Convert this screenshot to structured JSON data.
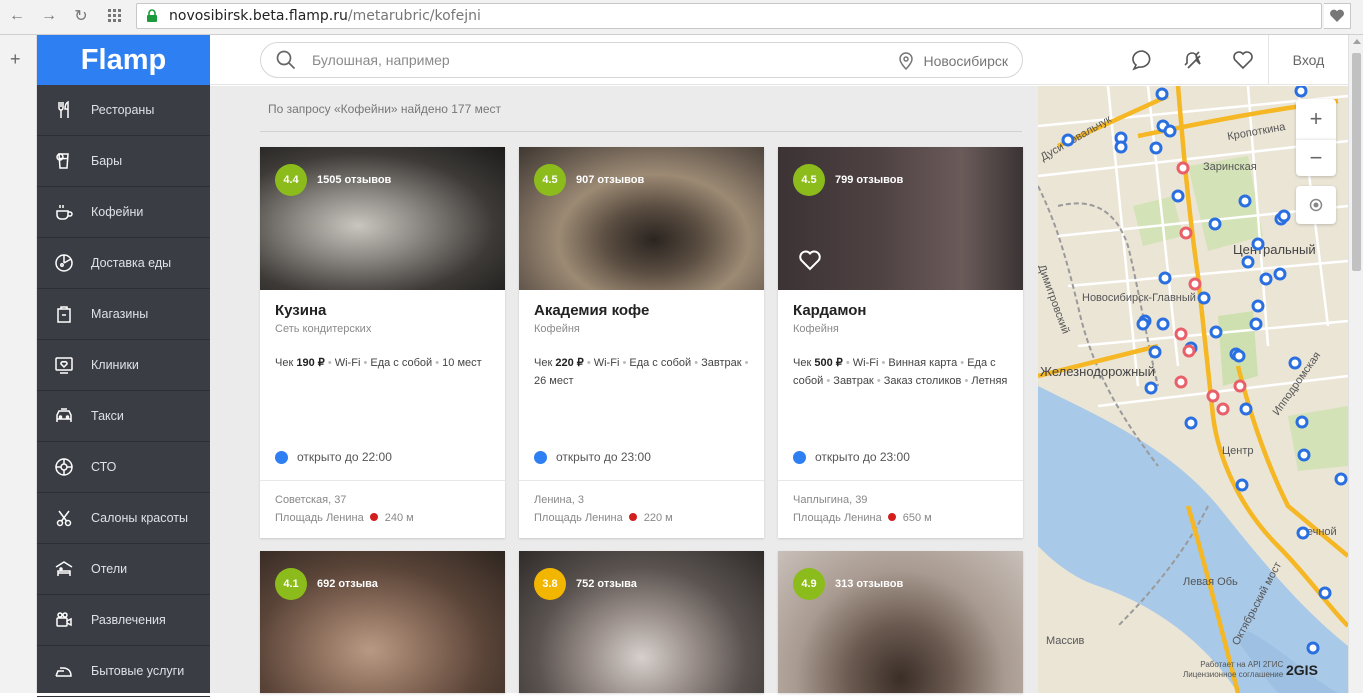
{
  "browser": {
    "url_host": "novosibirsk.beta.flamp.ru",
    "url_path": "/metarubric/kofejni"
  },
  "logo": "Flamp",
  "search": {
    "placeholder": "Булошная, например",
    "city": "Новосибирск"
  },
  "header": {
    "login": "Вход"
  },
  "sidebar": {
    "items": [
      {
        "label": "Рестораны",
        "icon": "utensils-icon"
      },
      {
        "label": "Бары",
        "icon": "glass-icon"
      },
      {
        "label": "Кофейни",
        "icon": "coffee-cup-icon"
      },
      {
        "label": "Доставка еды",
        "icon": "pizza-icon"
      },
      {
        "label": "Магазины",
        "icon": "shopping-bag-icon"
      },
      {
        "label": "Клиники",
        "icon": "heart-monitor-icon"
      },
      {
        "label": "Такси",
        "icon": "taxi-icon"
      },
      {
        "label": "СТО",
        "icon": "wheel-icon"
      },
      {
        "label": "Салоны красоты",
        "icon": "scissors-icon"
      },
      {
        "label": "Отели",
        "icon": "bed-icon"
      },
      {
        "label": "Развлечения",
        "icon": "camera-icon"
      },
      {
        "label": "Бытовые услуги",
        "icon": "iron-icon"
      }
    ]
  },
  "results": {
    "found_text": "По запросу «Кофейни» найдено 177 мест"
  },
  "cards": [
    {
      "rating": "4.4",
      "rating_color": "#8cbc1c",
      "reviews": "1505 отзывов",
      "name": "Кузина",
      "type": "Сеть кондитерских",
      "check_label": "Чек",
      "check": "190 ₽",
      "features": [
        "Wi-Fi",
        "Еда с собой",
        "10 мест"
      ],
      "open": "открыто до 22:00",
      "address": "Советская, 37",
      "metro": "Площадь Ленина",
      "distance": "240 м"
    },
    {
      "rating": "4.5",
      "rating_color": "#8cbc1c",
      "reviews": "907 отзывов",
      "name": "Академия кофе",
      "type": "Кофейня",
      "check_label": "Чек",
      "check": "220 ₽",
      "features": [
        "Wi-Fi",
        "Еда с собой",
        "Завтрак",
        "26 мест"
      ],
      "open": "открыто до 23:00",
      "address": "Ленина, 3",
      "metro": "Площадь Ленина",
      "distance": "220 м"
    },
    {
      "rating": "4.5",
      "rating_color": "#8cbc1c",
      "reviews": "799 отзывов",
      "name": "Кардамон",
      "type": "Кофейня",
      "check_label": "Чек",
      "check": "500 ₽",
      "features": [
        "Wi-Fi",
        "Винная карта",
        "Еда с собой",
        "Завтрак",
        "Заказ столиков",
        "Летняя"
      ],
      "open": "открыто до 23:00",
      "address": "Чаплыгина, 39",
      "metro": "Площадь Ленина",
      "distance": "650 м"
    },
    {
      "rating": "4.1",
      "rating_color": "#8cbc1c",
      "reviews": "692 отзыва"
    },
    {
      "rating": "3.8",
      "rating_color": "#f2b600",
      "reviews": "752 отзыва"
    },
    {
      "rating": "4.9",
      "rating_color": "#8cbc1c",
      "reviews": "313 отзывов"
    }
  ],
  "map": {
    "labels": {
      "kropotkina": "Кропоткина",
      "marinskaya": "Заринская",
      "central": "Центральный",
      "novosib": "Новосибирск-Главный",
      "zheleznodor": "Железнодорожный",
      "center": "Центр",
      "rechnoy": "Речной",
      "levaya": "Левая Обь",
      "oktyabr": "Октябрьский мост",
      "ippodrom": "Ипподромская",
      "dusi": "Дуси Ковальчук",
      "dimitrov": "Димитровский",
      "limassiva": "Массив"
    },
    "attribution_1": "Работает на API 2ГИС",
    "attribution_2": "Лицензионное соглашение",
    "brand": "2GIS"
  }
}
